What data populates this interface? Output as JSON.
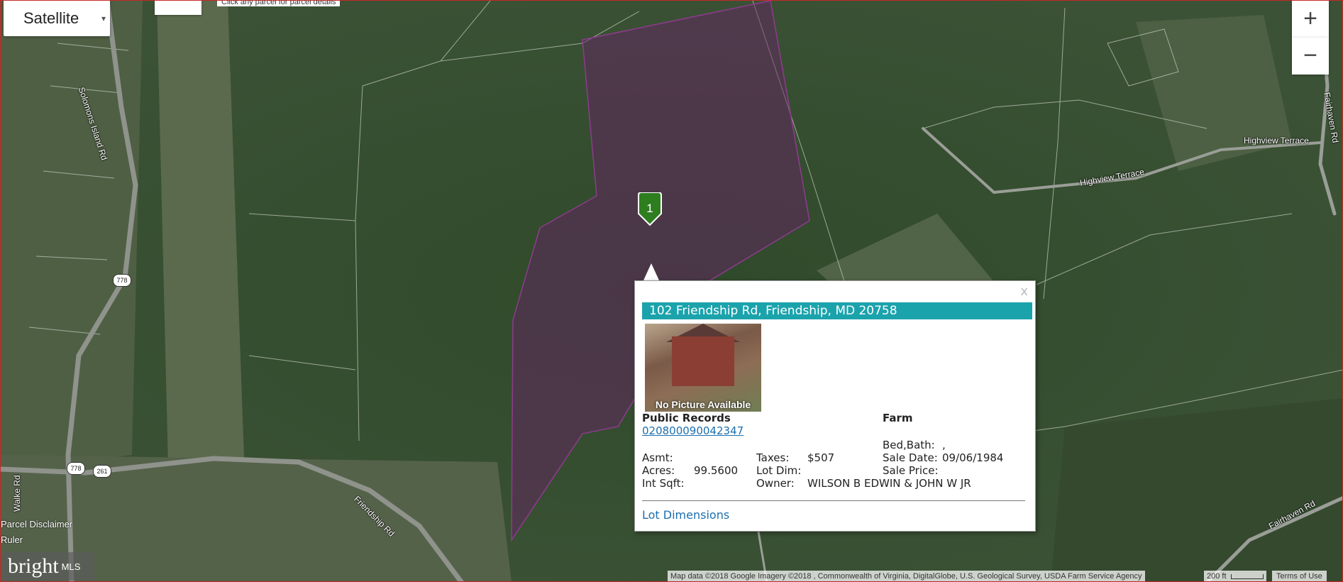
{
  "map_type_control": {
    "selected": "Satellite",
    "caret": "▾"
  },
  "hint": "Click any parcel for parcel details",
  "zoom": {
    "in": "+",
    "out": "−"
  },
  "road_labels": {
    "solomons": "Solomons Island Rd",
    "walke": "Walke Rd",
    "friendship": "Friendship Rd",
    "highview1": "Highview Terrace",
    "highview2": "Highview Terrace",
    "fairhaven_top": "Fairhaven Rd",
    "fairhaven_bottom": "Fairhaven Rd"
  },
  "route_shields": {
    "r778a": "778",
    "r778b": "778",
    "r261": "261"
  },
  "marker": {
    "label": "1",
    "color": "#2e7d1f"
  },
  "parcel": {
    "fill": "#6b1e6b"
  },
  "popup": {
    "close": "x",
    "address": "102 Friendship Rd, Friendship, MD 20758",
    "photo_caption": "No Picture Available",
    "section_title": "Public Records",
    "parcel_id": "020800090042347",
    "property_type": "Farm",
    "bed_bath_label": "Bed,Bath:",
    "bed_bath_value": ",",
    "asmt_label": "Asmt:",
    "asmt_value": "",
    "taxes_label": "Taxes:",
    "taxes_value": "$507",
    "sale_date_label": "Sale Date:",
    "sale_date_value": "09/06/1984",
    "acres_label": "Acres:",
    "acres_value": "99.5600",
    "lot_dim_label": "Lot Dim:",
    "lot_dim_value": "",
    "sale_price_label": "Sale Price:",
    "sale_price_value": "",
    "int_sqft_label": "Int Sqft:",
    "int_sqft_value": "",
    "owner_label": "Owner:",
    "owner_value": "WILSON B EDWIN & JOHN W JR",
    "lot_dimensions_link": "Lot Dimensions"
  },
  "side_links": {
    "disclaimer": "Parcel Disclaimer",
    "ruler": "Ruler"
  },
  "attribution": "Map data ©2018 Google Imagery ©2018 , Commonwealth of Virginia, DigitalGlobe, U.S. Geological Survey, USDA Farm Service Agency",
  "scale": "200 ft",
  "terms": "Terms of Use",
  "logo": {
    "brand": "bright",
    "suffix": "MLS"
  }
}
